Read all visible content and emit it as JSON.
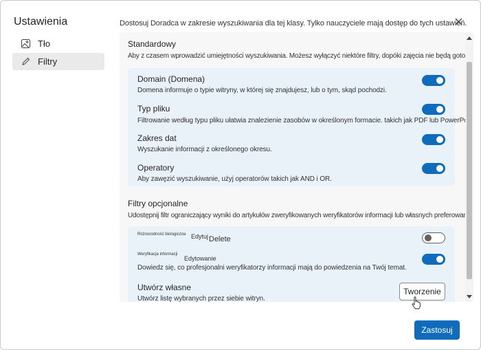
{
  "sidebar": {
    "title": "Ustawienia",
    "items": [
      {
        "label": "Tło",
        "icon": "image-icon",
        "selected": false
      },
      {
        "label": "Filtry",
        "icon": "pencil-icon",
        "selected": true
      }
    ]
  },
  "header": {
    "description": "Dostosuj Doradca w zakresie wyszukiwania dla tej klasy. Tylko nauczyciele mają dostęp do tych ustawień."
  },
  "standard": {
    "title": "Standardowy",
    "description": "Aby z czasem wprowadzić umiejętności wyszukiwania. Możesz wyłączyć niektóre filtry, dopóki zajęcia nie będą gotowe.",
    "filters": [
      {
        "title": "Domain (Domena)",
        "description": "Domena informuje o typie witryny, w której się znajdujesz, lub o tym, skąd pochodzi.",
        "on": true
      },
      {
        "title": "Typ pliku",
        "description": "Filtrowanie według typu pliku ułatwia znalezienie zasobów w określonym formacie. takich jak PDF lub PowerPoint.",
        "on": true
      },
      {
        "title": "Zakres dat",
        "description": "Wyszukanie informacji z określonego okresu.",
        "on": true
      },
      {
        "title": "Operatory",
        "description": "Aby zawęzić wyszukiwanie, użyj operatorów takich jak AND i OR.",
        "on": true
      }
    ]
  },
  "optional": {
    "title": "Filtry opcjonalne",
    "description": "Udostępnij filtr ograniczający wyniki do artykułów zweryfikowanych weryfikatorów informacji lub własnych preferowanych zasobów.",
    "biodiversity": {
      "label": "Różnorodność biologiczna",
      "edit": "Edytuj",
      "delete": "Delete",
      "on": false
    },
    "factcheck": {
      "label": "Weryfikacja informacji",
      "edit": "Edytowanie",
      "description": "Dowiedz się, co profesjonalni weryfikatorzy informacji mają do powiedzenia na Twój temat.",
      "on": true
    },
    "custom": {
      "title": "Utwórz własne",
      "description": "Utwórz listę wybranych przez siebie witryn.",
      "button": "Tworzenie"
    }
  },
  "footer": {
    "apply": "Zastosuj"
  },
  "colors": {
    "accent": "#0f6cbd",
    "card": "#e9f1f9"
  }
}
